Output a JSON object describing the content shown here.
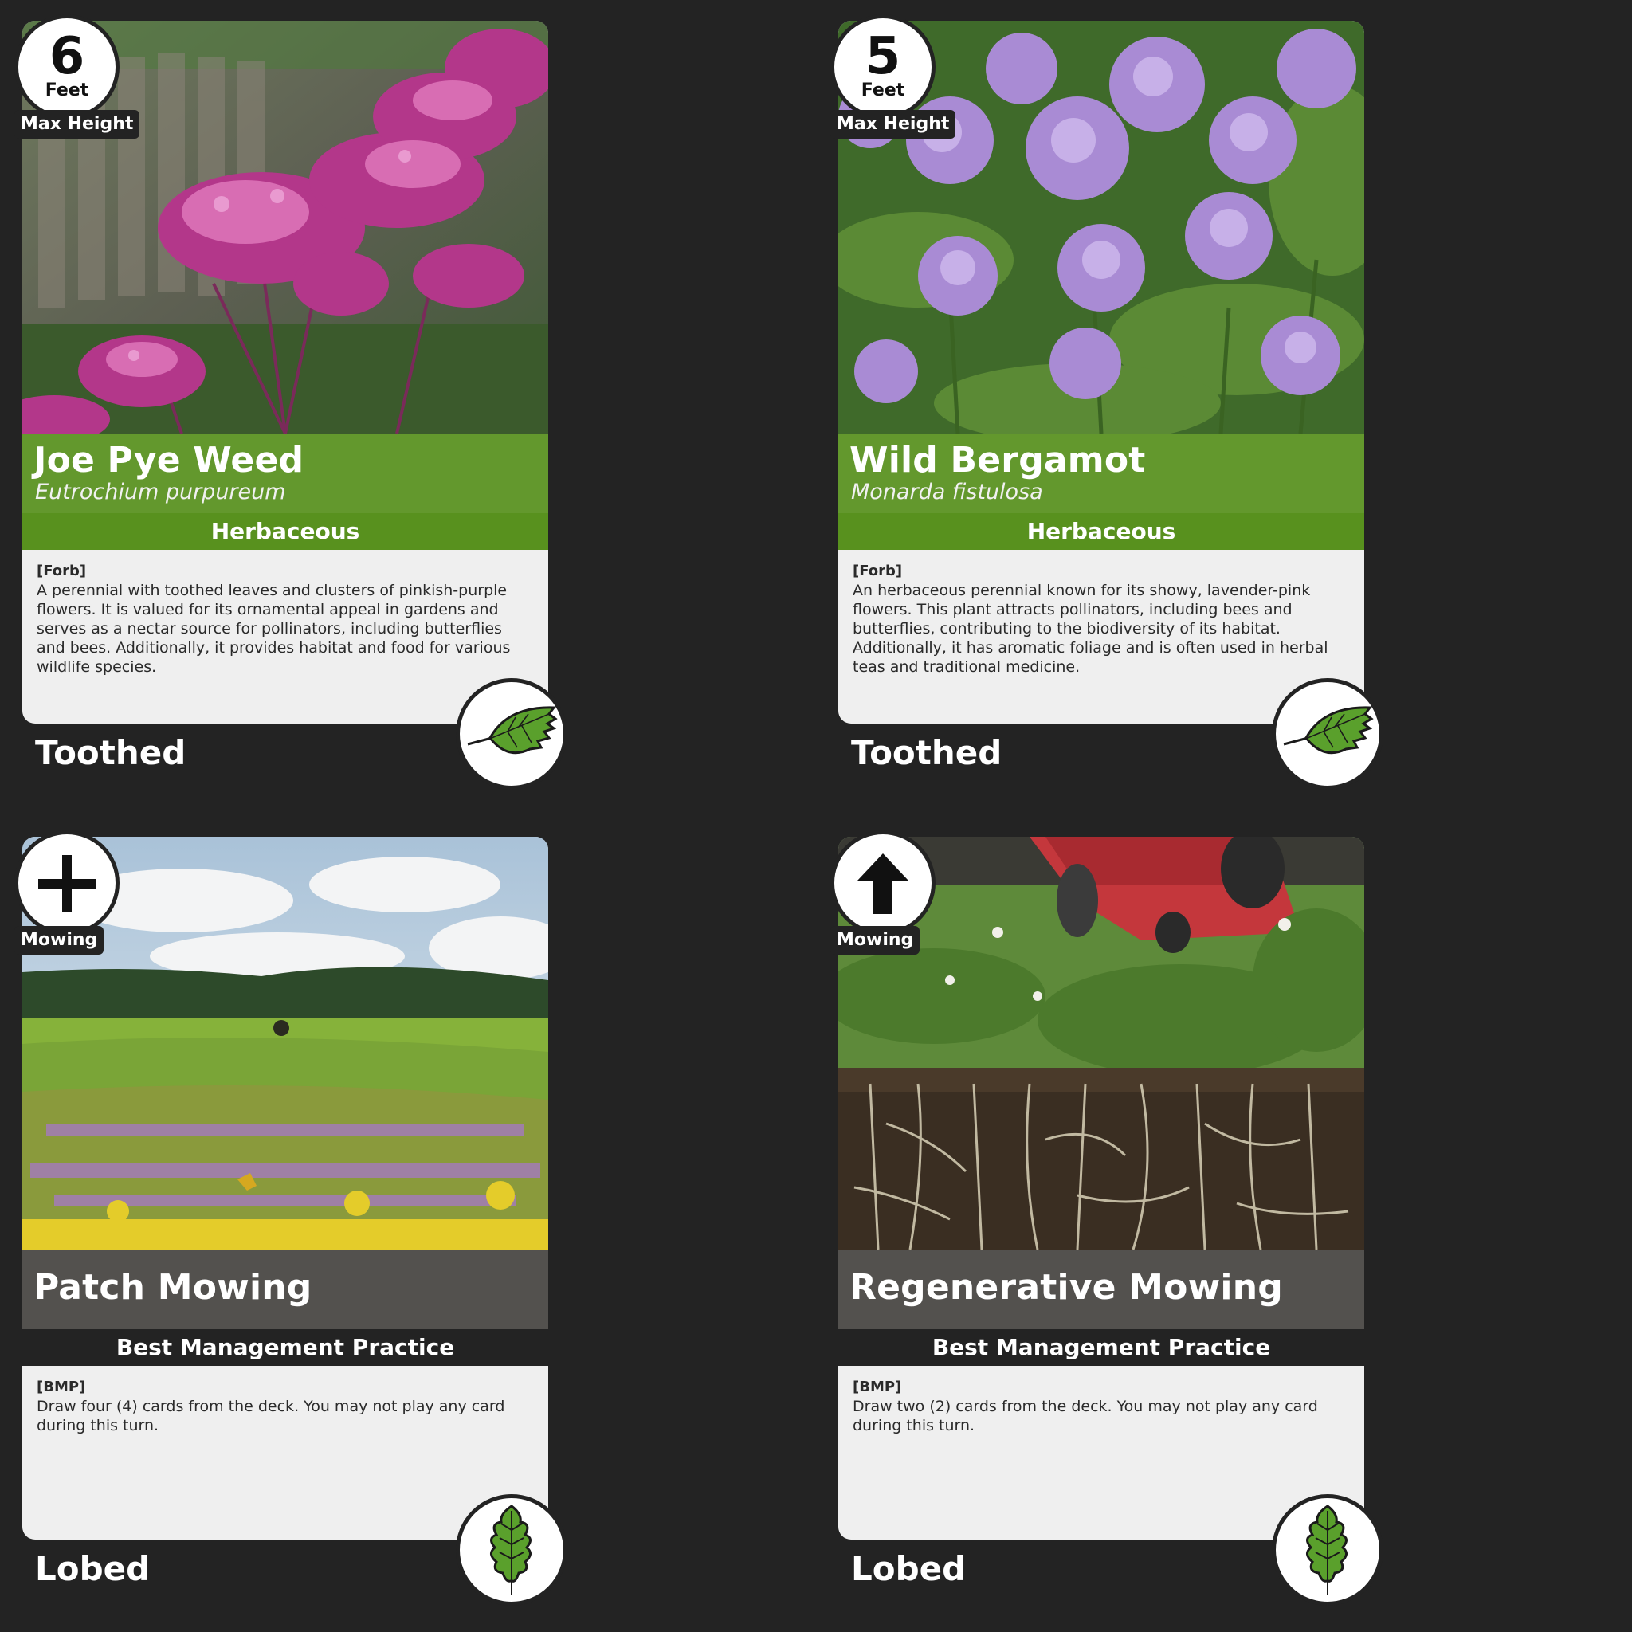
{
  "cards": [
    {
      "kind": "plant",
      "badge": {
        "value": "6",
        "unit": "Feet",
        "label": "Max Height",
        "icon": "number-badge"
      },
      "name": "Joe Pye Weed",
      "scientific": "Eutrochium purpureum",
      "type": "Herbaceous",
      "tag": "[Forb]",
      "description": "A perennial with toothed leaves and clusters of pinkish-purple flowers. It is valued for its ornamental appeal in gardens and serves as a nectar source for pollinators, including butterflies and bees. Additionally, it provides habitat and food for various wildlife species.",
      "leaf": "Toothed",
      "leaf_icon": "toothed-leaf-icon"
    },
    {
      "kind": "plant",
      "badge": {
        "value": "5",
        "unit": "Feet",
        "label": "Max Height",
        "icon": "number-badge"
      },
      "name": "Wild Bergamot",
      "scientific": "Monarda fistulosa",
      "type": "Herbaceous",
      "tag": "[Forb]",
      "description": "An herbaceous perennial known for its showy, lavender-pink flowers. This plant attracts pollinators, including bees and butterflies, contributing to the biodiversity of its habitat. Additionally, it has aromatic foliage and is often used in herbal teas and traditional medicine.",
      "leaf": "Toothed",
      "leaf_icon": "toothed-leaf-icon"
    },
    {
      "kind": "bmp",
      "badge": {
        "label": "Mowing",
        "icon": "plus-icon"
      },
      "name": "Patch Mowing",
      "type": "Best Management Practice",
      "tag": "[BMP]",
      "description": "Draw four (4) cards from the deck. You may not play any card during this turn.",
      "leaf": "Lobed",
      "leaf_icon": "lobed-leaf-icon"
    },
    {
      "kind": "bmp",
      "badge": {
        "label": "Mowing",
        "icon": "up-arrow-icon"
      },
      "name": "Regenerative Mowing",
      "type": "Best Management Practice",
      "tag": "[BMP]",
      "description": "Draw two (2) cards from the deck. You may not play any card during this turn.",
      "leaf": "Lobed",
      "leaf_icon": "lobed-leaf-icon"
    }
  ],
  "colors": {
    "background": "#232323",
    "plant_green": "#58911e",
    "card_body": "#efefef",
    "leaf_green": "#5aa02c"
  }
}
